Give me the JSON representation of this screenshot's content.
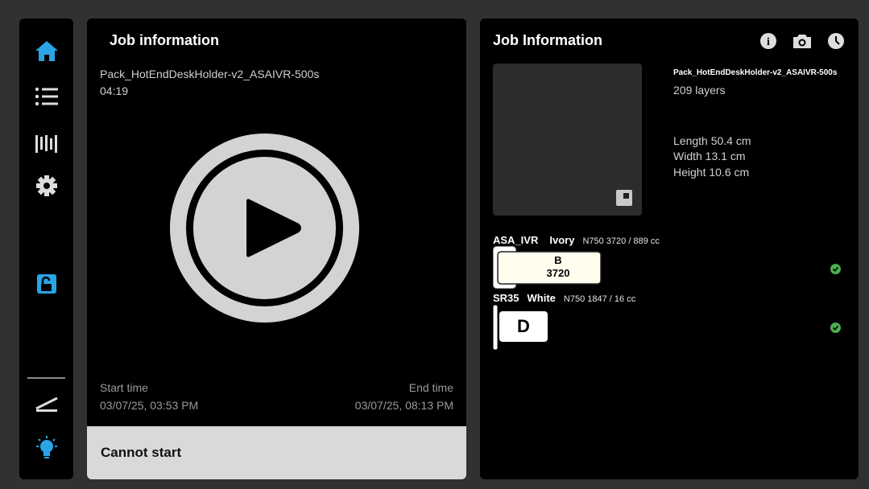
{
  "sidebar": {
    "icons": [
      "home-icon",
      "list-icon",
      "materials-icon",
      "gear-icon",
      "unlock-icon",
      "bed-level-icon",
      "lightbulb-icon"
    ],
    "accent": "#2aa4e6"
  },
  "left": {
    "title": "Job information",
    "job_name": "Pack_HotEndDeskHolder-v2_ASAIVR-500s",
    "duration": "04:19",
    "start_label": "Start time",
    "start_value": "03/07/25, 03:53 PM",
    "end_label": "End time",
    "end_value": "03/07/25, 08:13 PM",
    "action_label": "Cannot start"
  },
  "right": {
    "title": "Job Information",
    "header_icons": [
      "info-icon",
      "camera-icon",
      "history-icon"
    ],
    "job_name": "Pack_HotEndDeskHolder-v2_ASAIVR-500s",
    "layers": "209 layers",
    "length": "Length 50.4 cm",
    "width": "Width 13.1 cm",
    "height": "Height 10.6 cm",
    "materials": [
      {
        "name": "ASA_IVR",
        "color": "Ivory",
        "detail": "N750 3720 / 889 cc",
        "slot": "B",
        "code": "3720",
        "ok": true
      },
      {
        "name": "SR35",
        "color": "White",
        "detail": "N750 1847 / 16 cc",
        "slot": "D",
        "ok": true
      }
    ],
    "status_color": "#4caf50"
  }
}
